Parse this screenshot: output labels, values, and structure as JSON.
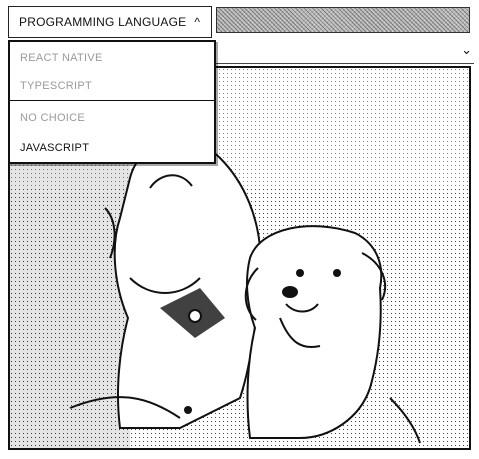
{
  "dropdown": {
    "label": "PROGRAMMING LANGUAGE",
    "chevron": "^",
    "items": [
      {
        "label": "REACT NATIVE",
        "dimmed": true
      },
      {
        "label": "TYPESCRIPT",
        "dimmed": true
      },
      {
        "label": "NO CHOICE",
        "dimmed": true
      },
      {
        "label": "JAVASCRIPT",
        "dimmed": false
      }
    ]
  },
  "select": {
    "chevron": "⌄"
  },
  "image": {
    "subject": "two fluffy dogs photo"
  },
  "icons": [
    "chevron-up-icon",
    "chevron-down-icon"
  ],
  "colors": {
    "border": "#111111",
    "dimmed_text": "#9a9a9a"
  }
}
